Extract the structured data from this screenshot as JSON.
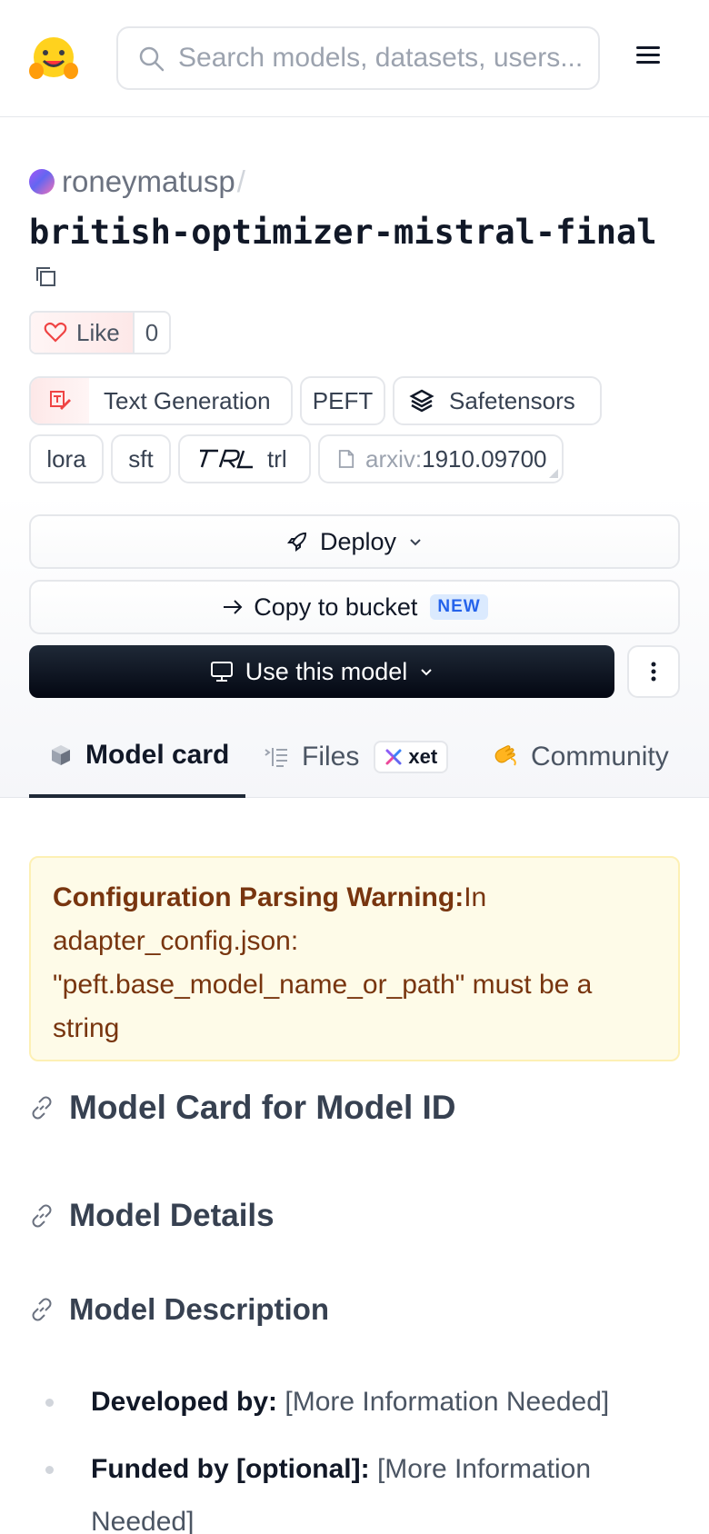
{
  "header": {
    "search_placeholder": "Search models, datasets, users..."
  },
  "repo": {
    "owner": "roneymatusp",
    "separator": "/",
    "name": "british-optimizer-mistral-final",
    "like_label": "Like",
    "like_count": "0"
  },
  "tags": {
    "task": "Text Generation",
    "library": "PEFT",
    "format": "Safetensors",
    "tag1": "lora",
    "tag2": "sft",
    "tag3": "trl",
    "arxiv_prefix": "arxiv:",
    "arxiv_id": "1910.09700"
  },
  "actions": {
    "deploy": "Deploy",
    "copy_bucket": "Copy to bucket",
    "new_badge": "NEW",
    "use_model": "Use this model"
  },
  "tabs": {
    "model_card": "Model card",
    "files": "Files",
    "xet": "xet",
    "community": "Community"
  },
  "warning": {
    "title": "Configuration Parsing Warning:",
    "body": "In adapter_config.json: \"peft.base_model_name_or_path\" must be a string"
  },
  "content": {
    "h1": "Model Card for Model ID",
    "h2": "Model Details",
    "h3": "Model Description",
    "items": [
      {
        "key": "Developed by:",
        "value": "[More Information Needed]"
      },
      {
        "key": "Funded by [optional]:",
        "value": "[More Information Needed]"
      }
    ]
  },
  "colors": {
    "accent_dark": "#030712",
    "warning_bg": "#fefbe8",
    "warning_text": "#78350f",
    "new_badge": "#2563eb"
  }
}
